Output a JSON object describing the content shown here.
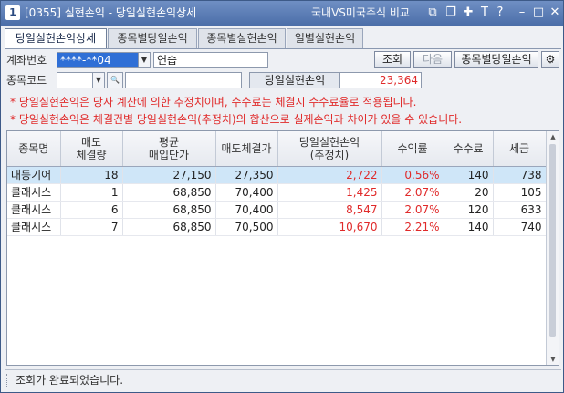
{
  "titlebar": {
    "app_icon": "1",
    "title": "[0355] 실현손익 - 당일실현손익상세",
    "right_text": "국내VS미국주식 비교",
    "buttons": [
      "link-icon",
      "window-restore-icon",
      "pin-icon",
      "font-size-icon",
      "help-icon",
      "minimize-icon",
      "maximize-icon",
      "close-icon"
    ]
  },
  "tabs": [
    "당일실현손익상세",
    "종목별당일손익",
    "종목별실현손익",
    "일별실현손익"
  ],
  "account": {
    "label": "계좌번호",
    "value": "****-**04",
    "name": "연습"
  },
  "stock": {
    "label": "종목코드",
    "value": "",
    "name": ""
  },
  "buttons": {
    "query": "조회",
    "next": "다음",
    "by_stock": "종목별당일손익"
  },
  "summary": {
    "label": "당일실현손익",
    "value": "23,364"
  },
  "notices": [
    "* 당일실현손익은 당사 계산에 의한 추정치이며, 수수료는 체결시 수수료율로 적용됩니다.",
    "* 당일실현손익은 체결건별 당일실현손익(추정치)의 합산으로 실제손익과 차이가 있을 수 있습니다."
  ],
  "table": {
    "headers": [
      [
        "종목명"
      ],
      [
        "매도",
        "체결량"
      ],
      [
        "평균",
        "매입단가"
      ],
      [
        "매도체결가"
      ],
      [
        "당일실현손익",
        "(추정치)"
      ],
      [
        "수익률"
      ],
      [
        "수수료"
      ],
      [
        "세금"
      ]
    ],
    "rows": [
      {
        "name": "대동기어",
        "qty": "18",
        "avg_price": "27,150",
        "sell_price": "27,350",
        "pnl": "2,722",
        "rate": "0.56%",
        "fee": "140",
        "tax": "738"
      },
      {
        "name": "클래시스",
        "qty": "1",
        "avg_price": "68,850",
        "sell_price": "70,400",
        "pnl": "1,425",
        "rate": "2.07%",
        "fee": "20",
        "tax": "105"
      },
      {
        "name": "클래시스",
        "qty": "6",
        "avg_price": "68,850",
        "sell_price": "70,400",
        "pnl": "8,547",
        "rate": "2.07%",
        "fee": "120",
        "tax": "633"
      },
      {
        "name": "클래시스",
        "qty": "7",
        "avg_price": "68,850",
        "sell_price": "70,500",
        "pnl": "10,670",
        "rate": "2.21%",
        "fee": "140",
        "tax": "740"
      }
    ]
  },
  "status": "조회가 완료되었습니다.",
  "colors": {
    "titlebar": "#4b6ea8",
    "highlight": "#e02a2a",
    "selected_row": "#cfe6f8"
  }
}
